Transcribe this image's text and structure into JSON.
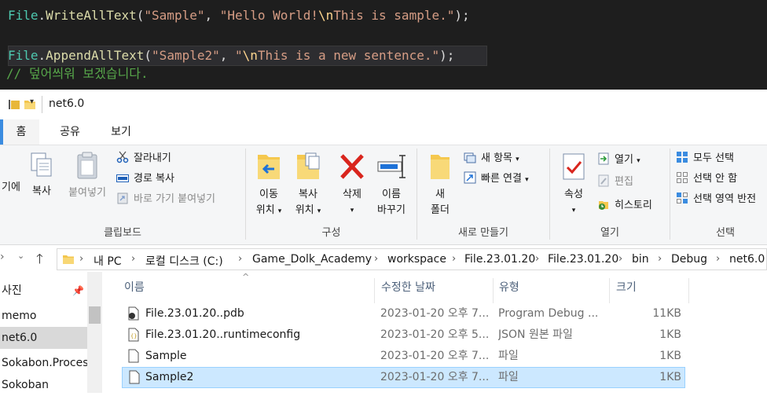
{
  "editor": {
    "line1": {
      "cls": "File",
      "dot": ".",
      "method": "WriteAllText",
      "open": "(",
      "str1": "\"Sample\"",
      "comma": ", ",
      "str2a": "\"Hello World!",
      "esc": "\\n",
      "str2b": "This is sample.\"",
      "close": ");"
    },
    "line2": {
      "cls": "File",
      "dot": ".",
      "method": "AppendAllText",
      "open": "(",
      "str1": "\"Sample2\"",
      "comma": ", ",
      "str2a": "\"",
      "esc": "\\n",
      "str2b": "This is a new sentence.\"",
      "close": ");"
    },
    "line3": "// 덮어씌워 보겠습니다."
  },
  "window": {
    "title": "net6.0"
  },
  "tabs": [
    {
      "label": "홈"
    },
    {
      "label": "공유"
    },
    {
      "label": "보기"
    }
  ],
  "ribbon": {
    "clipboard": {
      "label": "클립보드",
      "pin_partial": "기에",
      "copy": "복사",
      "paste": "붙여넣기",
      "cut": "잘라내기",
      "copy_path": "경로 복사",
      "paste_shortcut": "바로 가기 붙여넣기"
    },
    "organize": {
      "label": "구성",
      "move_to_1": "이동",
      "move_to_2": "위치",
      "copy_to_1": "복사",
      "copy_to_2": "위치",
      "delete": "삭제",
      "rename_1": "이름",
      "rename_2": "바꾸기"
    },
    "new": {
      "label": "새로 만들기",
      "new_folder_1": "새",
      "new_folder_2": "폴더",
      "new_item": "새 항목",
      "easy_access": "빠른 연결"
    },
    "open": {
      "label": "열기",
      "properties": "속성",
      "open": "열기",
      "edit": "편집",
      "history": "히스토리"
    },
    "select": {
      "label": "선택",
      "select_all": "모두 선택",
      "select_none": "선택 안 함",
      "invert": "선택 영역 반전"
    }
  },
  "address": {
    "crumbs": [
      "내 PC",
      "로컬 디스크 (C:)",
      "Game_Dolk_Academy",
      "workspace",
      "File.23.01.20",
      "File.23.01.20",
      "bin",
      "Debug",
      "net6.0"
    ]
  },
  "nav_pane": {
    "items": [
      "사진",
      "memo",
      "net6.0",
      "Sokabon.Process",
      "Sokoban"
    ]
  },
  "file_list": {
    "columns": {
      "name": "이름",
      "modified": "수정한 날짜",
      "type": "유형",
      "size": "크기"
    },
    "rows": [
      {
        "name": "File.23.01.20..pdb",
        "modified": "2023-01-20 오후 7...",
        "type": "Program Debug ...",
        "size": "11KB"
      },
      {
        "name": "File.23.01.20..runtimeconfig",
        "modified": "2023-01-20 오후 5...",
        "type": "JSON 원본 파일",
        "size": "1KB"
      },
      {
        "name": "Sample",
        "modified": "2023-01-20 오후 7...",
        "type": "파일",
        "size": "1KB"
      },
      {
        "name": "Sample2",
        "modified": "2023-01-20 오후 7...",
        "type": "파일",
        "size": "1KB"
      }
    ]
  }
}
